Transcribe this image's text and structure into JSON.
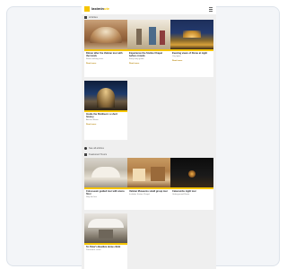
{
  "app": {
    "logo_main": "lastmin",
    "logo_accent": "ute"
  },
  "sections": {
    "first_heading": "Articles",
    "second_heading": "Featured Tours"
  },
  "cards_top": [
    {
      "title": "Dinner after the Vatican tour with the locals",
      "subtitle": "Rome walking tours",
      "tag": "Read more"
    },
    {
      "title": "Experience the Sistine Chapel before crowds",
      "subtitle": "Early entry guide",
      "tag": "Read more"
    },
    {
      "title": "Evening views of Rome at night",
      "subtitle": "City lights",
      "tag": "Read more"
    },
    {
      "title": "Inside the Pantheon: a short history",
      "subtitle": "Ancient Rome",
      "tag": "Read more"
    }
  ],
  "more_link": "See all articles",
  "cards_bottom": [
    {
      "title": "Colosseum guided tour with arena floor",
      "subtitle": "Skip the line",
      "tag": "Book now"
    },
    {
      "title": "Vatican Museums small group tour",
      "subtitle": "Includes Sistine Chapel",
      "tag": "Book now"
    },
    {
      "title": "Catacombs night tour",
      "subtitle": "Underground Rome",
      "tag": "Book now"
    },
    {
      "title": "St. Peter's Basilica dome climb",
      "subtitle": "Panoramic views",
      "tag": "Book now"
    }
  ],
  "colors": {
    "accent": "#f6c500",
    "page_bg": "#efefef",
    "frame_bg": "#f3f5f8"
  }
}
